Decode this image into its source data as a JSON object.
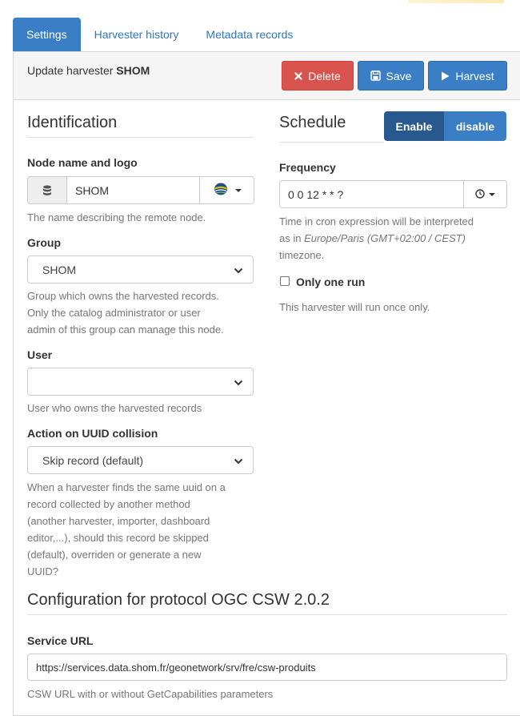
{
  "tabs": [
    {
      "label": "Settings"
    },
    {
      "label": "Harvester history"
    },
    {
      "label": "Metadata records"
    }
  ],
  "header": {
    "title_prefix": "Update harvester",
    "title_name": "SHOM",
    "delete_label": "Delete",
    "save_label": "Save",
    "harvest_label": "Harvest"
  },
  "identification": {
    "title": "Identification",
    "node_label": "Node name and logo",
    "node_value": "SHOM",
    "node_help": "The name describing the remote node.",
    "group_label": "Group",
    "group_value": "SHOM",
    "group_help": [
      "Group which owns the harvested records.",
      "Only the catalog administrator or user",
      "admin of this group can manage this node."
    ],
    "user_label": "User",
    "user_value": "",
    "user_help": "User who owns the harvested records",
    "uuid_label": "Action on UUID collision",
    "uuid_value": "Skip record (default)",
    "uuid_help": [
      "When a harvester finds the same uuid on a",
      "record collected by another method",
      "(another harvester, importer, dashboard",
      "editor,...), should this record be skipped",
      "(default), overriden or generate a new",
      "UUID?"
    ]
  },
  "schedule": {
    "title": "Schedule",
    "enable_label": "Enable",
    "disable_label": "disable",
    "frequency_label": "Frequency",
    "frequency_value": "0 0 12 * * ?",
    "help_line1": "Time in cron expression will be interpreted",
    "help_line2_prefix": "as in ",
    "help_timezone": "Europe/Paris (GMT+02:00 / CEST)",
    "help_line3": "timezone.",
    "only_one_run_label": "Only one run",
    "only_one_run_checked": false,
    "only_one_run_help": "This harvester will run once only."
  },
  "protocol": {
    "title": "Configuration for protocol OGC CSW 2.0.2",
    "url_label": "Service URL",
    "url_value": "https://services.data.shom.fr/geonetwork/srv/fre/csw-produits",
    "url_help": "CSW URL with or without GetCapabilities parameters"
  },
  "colors": {
    "primary": "#3a7fc6",
    "primary_dark": "#28598e",
    "danger": "#d9534f"
  },
  "icons": {
    "delete": "times-icon",
    "save": "floppy-icon",
    "harvest": "play-icon",
    "node": "database-icon",
    "logo": "globe-logo",
    "clock": "clock-icon"
  }
}
